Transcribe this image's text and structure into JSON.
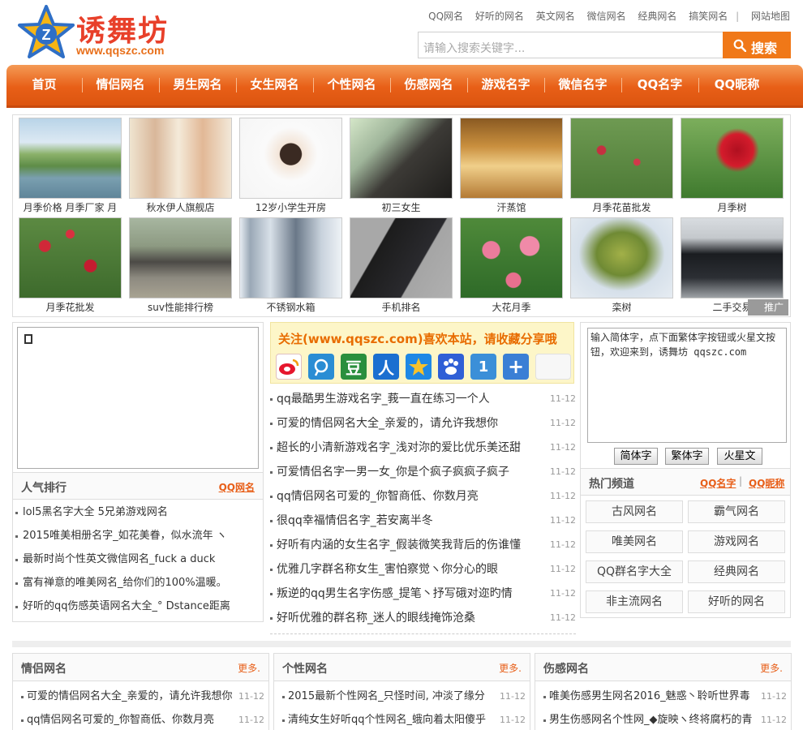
{
  "header": {
    "logo_name": "诱舞坊",
    "logo_url": "www.qqszc.com",
    "top_links": [
      "QQ网名",
      "好听的网名",
      "英文网名",
      "微信网名",
      "经典网名",
      "搞笑网名",
      "网站地图"
    ],
    "search_placeholder": "请输入搜索关键字...",
    "search_button": "搜索"
  },
  "nav": [
    "首页",
    "情侣网名",
    "男生网名",
    "女生网名",
    "个性网名",
    "伤感网名",
    "游戏名字",
    "微信名字",
    "QQ名字",
    "QQ昵称"
  ],
  "gallery": {
    "row1": [
      "月季价格 月季厂家 月",
      "秋水伊人旗舰店",
      "12岁小学生开房",
      "初三女生",
      "汗蒸馆",
      "月季花苗批发",
      "月季树"
    ],
    "row2": [
      "月季花批发",
      "suv性能排行榜",
      "不锈钢水箱",
      "手机排名",
      "大花月季",
      "栾树",
      "二手交易"
    ],
    "ad_tag": "推广"
  },
  "popular": {
    "title": "人气排行",
    "more": "QQ网名",
    "items": [
      "lol5黑名字大全 5兄弟游戏网名",
      "2015唯美相册名字_如花美眷，似水流年 ヽ",
      "最新时尚个性英文微信网名_fuck a duck",
      "富有禅意的唯美网名_给你们的100%温暖。",
      "好听的qq伤感英语网名大全_° Dstance距离"
    ]
  },
  "share": {
    "title": "关注(www.qqszc.com)喜欢本站，请收藏分享哦"
  },
  "mid_list": [
    {
      "text": "qq最酷男生游戏名字_莪一直在练习一个人",
      "date": "11-12"
    },
    {
      "text": "可爱的情侣网名大全_亲爱的，请允许我想你",
      "date": "11-12"
    },
    {
      "text": "超长的小清新游戏名字_浅对沵的爱比优乐美还甜",
      "date": "11-12"
    },
    {
      "text": "可爱情侣名字一男一女_你是个疯子疯疯子疯子",
      "date": "11-12"
    },
    {
      "text": "qq情侣网名可爱的_你智商低、你数月亮",
      "date": "11-12"
    },
    {
      "text": "很qq幸福情侣名字_若安离半冬",
      "date": "11-12"
    },
    {
      "text": "好听有内涵的女生名字_假装微笑我背后的伤谁懂",
      "date": "11-12"
    },
    {
      "text": "优雅几字群名称女生_害怕察觉ヽ你分心的眼",
      "date": "11-12"
    },
    {
      "text": "叛逆的qq男生名字伤感_提笔丶抒写硪对迩旳情",
      "date": "11-12"
    },
    {
      "text": "好听优雅的群名称_迷人的眼线掩饰沧桑",
      "date": "11-12"
    }
  ],
  "converter": {
    "text": "输入简体字，点下面繁体字按钮或火星文按钮，欢迎来到，诱舞坊 qqszc.com",
    "buttons": [
      "简体字",
      "繁体字",
      "火星文"
    ]
  },
  "hot_channels": {
    "title": "热门频道",
    "links": [
      "QQ名字",
      "QQ昵称"
    ],
    "items": [
      "古风网名",
      "霸气网名",
      "唯美网名",
      "游戏网名",
      "QQ群名字大全",
      "经典网名",
      "非主流网名",
      "好听的网名"
    ]
  },
  "bottom_boxes": [
    {
      "title": "情侣网名",
      "more": "更多.",
      "items": [
        {
          "text": "可爱的情侣网名大全_亲爱的，请允许我想你",
          "date": "11-12"
        },
        {
          "text": "qq情侣网名可爱的_你智商低、你数月亮",
          "date": "11-12"
        }
      ]
    },
    {
      "title": "个性网名",
      "more": "更多.",
      "items": [
        {
          "text": "2015最新个性网名_只怪时间, 冲淡了缘分",
          "date": "11-12"
        },
        {
          "text": "清纯女生好听qq个性网名_蛾向着太阳傻乎",
          "date": "11-12"
        }
      ]
    },
    {
      "title": "伤感网名",
      "more": "更多.",
      "items": [
        {
          "text": "唯美伤感男生网名2016_魅惑丶聆听世界毒",
          "date": "11-12"
        },
        {
          "text": "男生伤感网名个性网_◆旋映ヽ终将腐朽的青",
          "date": "11-12"
        }
      ]
    }
  ],
  "colors": {
    "accent": "#f07818",
    "nav": "#e85f17",
    "logo_red": "#e8402a"
  }
}
